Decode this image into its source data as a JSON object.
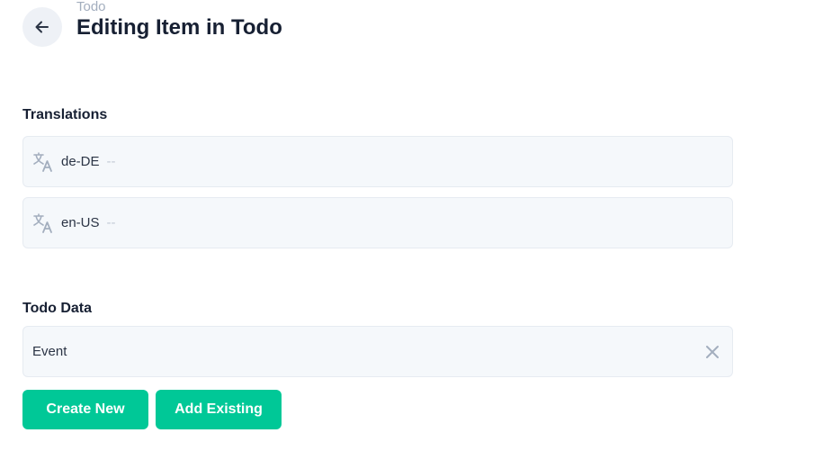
{
  "header": {
    "breadcrumb": "Todo",
    "title": "Editing Item in Todo"
  },
  "translations": {
    "label": "Translations",
    "items": [
      {
        "code": "de-DE",
        "value": "--"
      },
      {
        "code": "en-US",
        "value": "--"
      }
    ]
  },
  "todo_data": {
    "label": "Todo Data",
    "items": [
      {
        "label": "Event"
      }
    ]
  },
  "actions": {
    "create_new": "Create New",
    "add_existing": "Add Existing"
  },
  "colors": {
    "accent": "#00c897",
    "field_bg": "#f5f8fb",
    "icon_gray": "#a3aebe"
  },
  "icons": {
    "back": "arrow-left-icon",
    "translate": "translate-icon",
    "remove": "close-icon"
  }
}
